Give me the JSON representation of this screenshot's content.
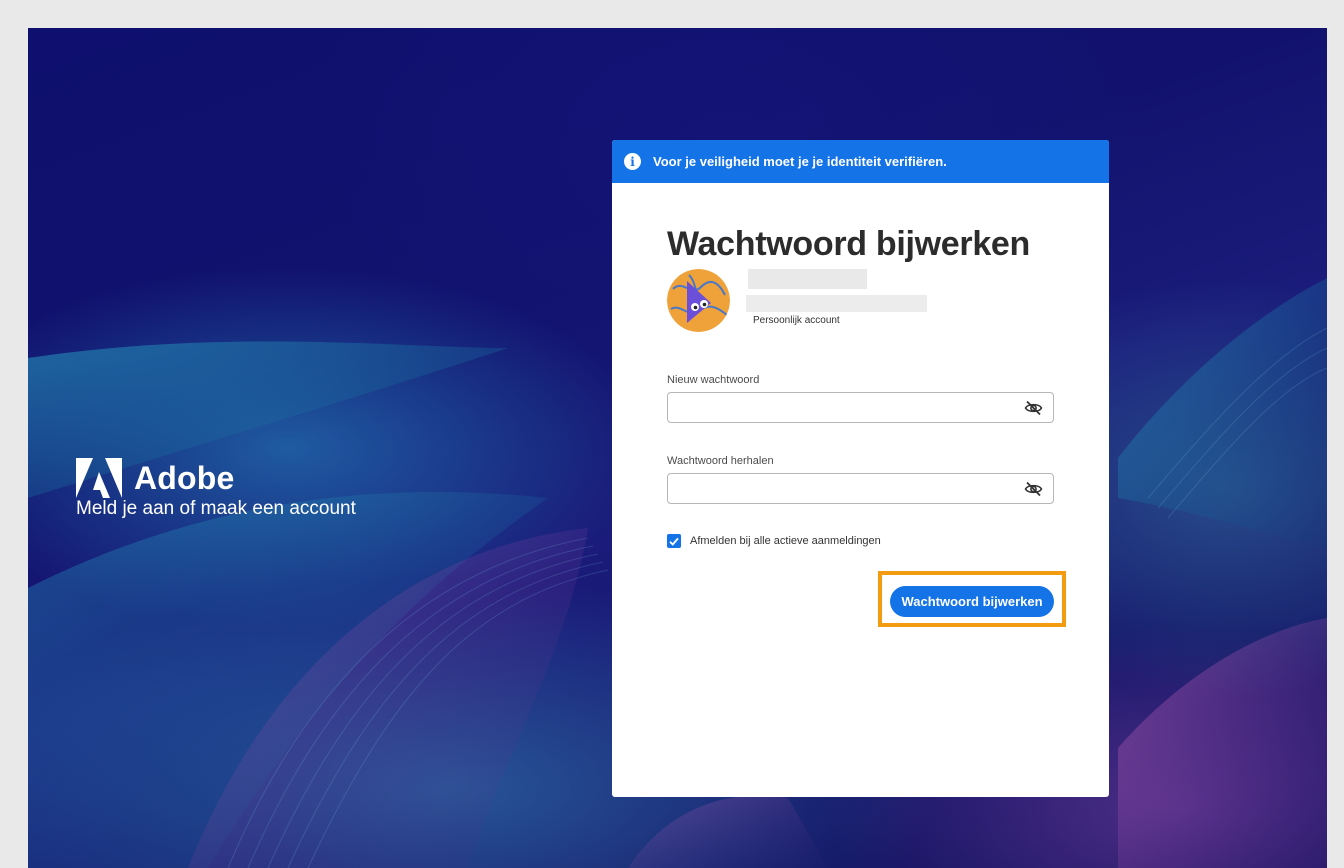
{
  "brand": {
    "name": "Adobe",
    "tagline": "Meld je aan of maak een account"
  },
  "banner": {
    "message": "Voor je veiligheid moet je je identiteit verifiëren."
  },
  "form": {
    "title": "Wachtwoord bijwerken",
    "account_type": "Persoonlijk account",
    "new_password_label": "Nieuw wachtwoord",
    "new_password_value": "",
    "repeat_password_label": "Wachtwoord herhalen",
    "repeat_password_value": "",
    "signout_all_label": "Afmelden bij alle actieve aanmeldingen",
    "signout_all_checked": true,
    "submit_label": "Wachtwoord bijwerken"
  },
  "icons": {
    "banner": "info-icon",
    "password_toggle": "eye-off-icon",
    "checkbox": "checkmark-icon"
  },
  "colors": {
    "accent": "#1473e6",
    "highlight": "#f39c12",
    "background": "#12126e"
  }
}
